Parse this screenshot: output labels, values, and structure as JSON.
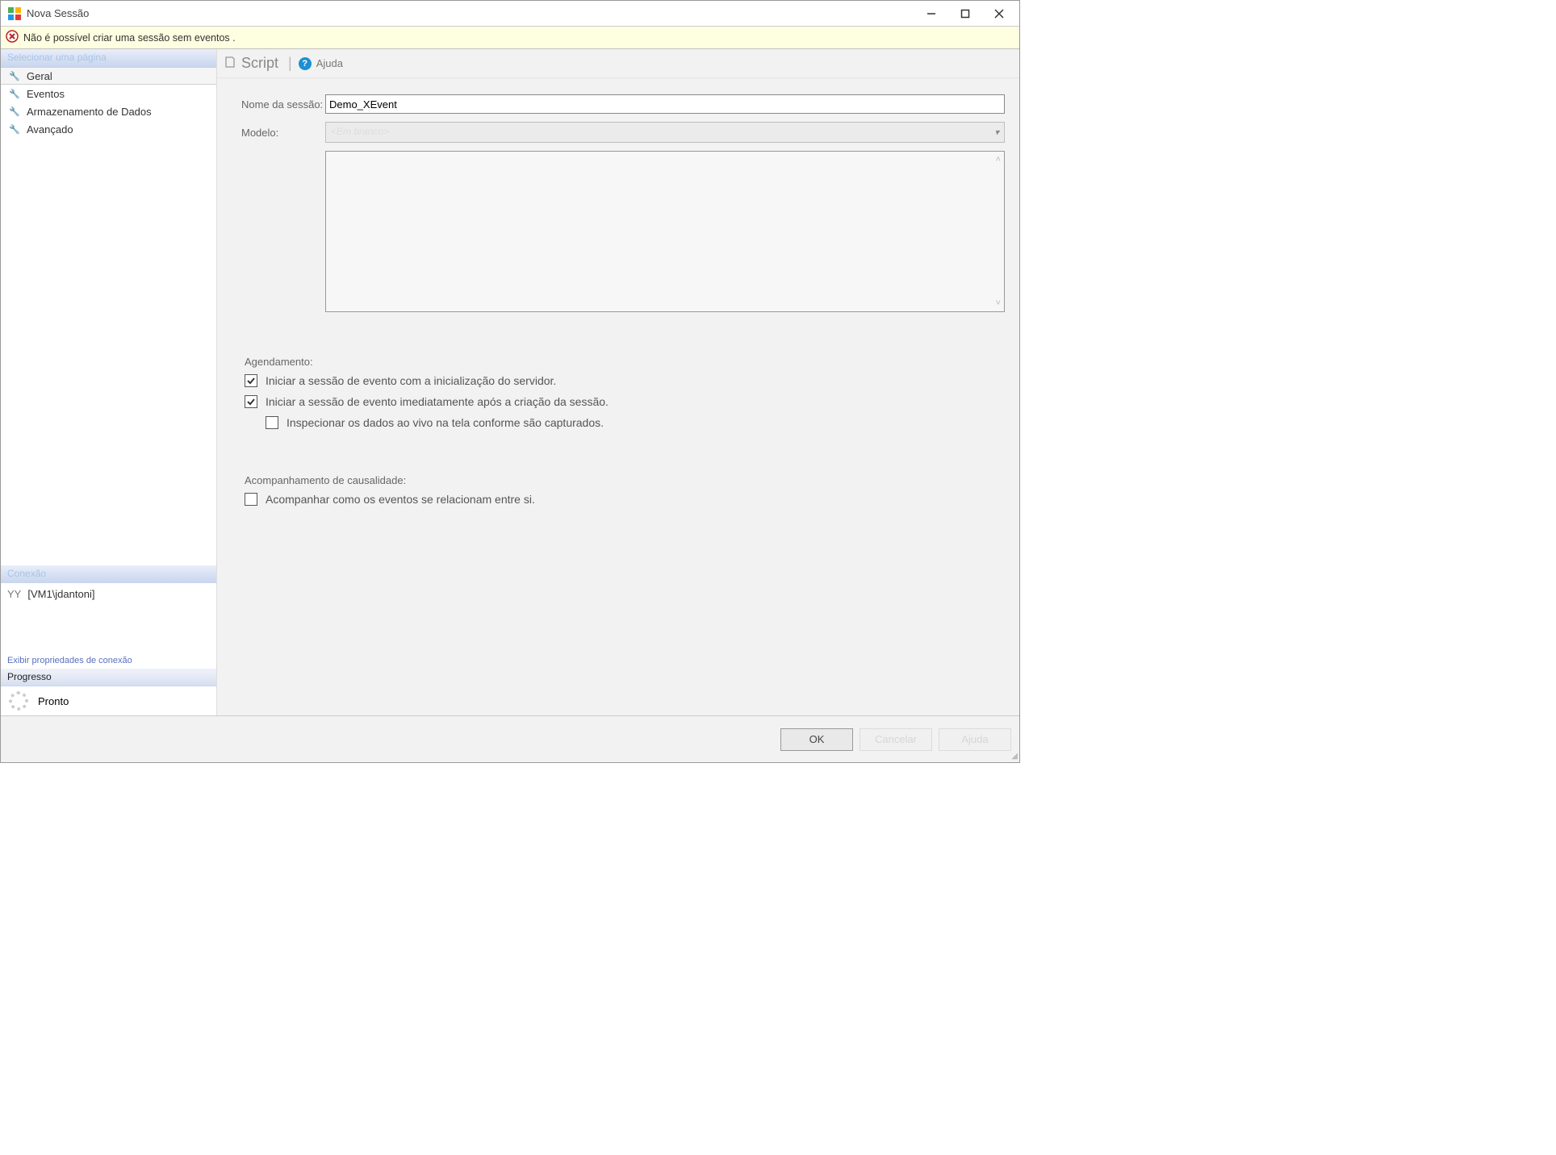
{
  "window": {
    "title": "Nova Sessão"
  },
  "error_bar": {
    "message": "Não é possível criar uma sessão sem eventos ."
  },
  "sidebar": {
    "select_page_label": "Selecionar uma página",
    "pages": [
      {
        "label": "Geral"
      },
      {
        "label": "Eventos"
      },
      {
        "label": "Armazenamento de Dados"
      },
      {
        "label": "Avançado"
      }
    ],
    "connection_label": "Conexão",
    "connection_prefix": "YY",
    "connection_value": "[VM1\\jdantoni]",
    "connection_link": "Exibir propriedades de conexão",
    "progress_label": "Progresso",
    "progress_status": "Pronto"
  },
  "toolbar": {
    "script_label": "Script",
    "help_label": "Ajuda"
  },
  "form": {
    "session_name_label": "Nome da sessão:",
    "session_name_value": "Demo_XEvent",
    "template_label": "Modelo:",
    "template_value": "<Em branco>",
    "schedule_label": "Agendamento:",
    "chk_start_with_server": {
      "checked": true,
      "label": "Iniciar a sessão de evento com a inicialização do servidor."
    },
    "chk_start_immediately": {
      "checked": true,
      "label": "Iniciar a sessão de evento imediatamente após a criação da sessão."
    },
    "chk_live_watch": {
      "checked": false,
      "label": "Inspecionar os dados ao vivo na tela conforme são capturados."
    },
    "causality_label": "Acompanhamento de causalidade:",
    "chk_causality": {
      "checked": false,
      "label": "Acompanhar como os eventos se relacionam entre si."
    }
  },
  "footer": {
    "ok": "OK",
    "cancel": "Cancelar",
    "help": "Ajuda"
  }
}
